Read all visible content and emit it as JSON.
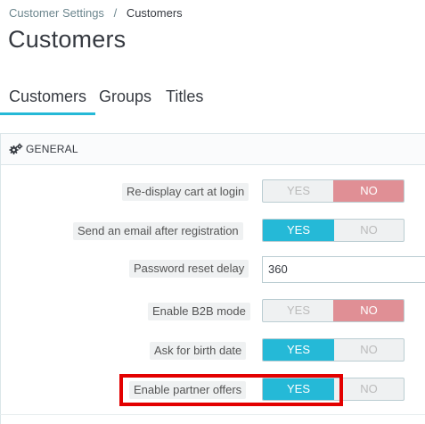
{
  "breadcrumb": {
    "parent": "Customer Settings",
    "separator": "/",
    "current": "Customers"
  },
  "page_title": "Customers",
  "tabs": [
    {
      "label": "Customers",
      "active": true
    },
    {
      "label": "Groups",
      "active": false
    },
    {
      "label": "Titles",
      "active": false
    }
  ],
  "panel": {
    "icon": "cogs-icon",
    "title": "GENERAL",
    "fields": [
      {
        "label": "Re-display cart at login",
        "type": "switch",
        "yes": "YES",
        "no": "NO",
        "value": "NO"
      },
      {
        "label": "Send an email after registration",
        "type": "switch",
        "yes": "YES",
        "no": "NO",
        "value": "YES"
      },
      {
        "label": "Password reset delay",
        "type": "text",
        "value": "360"
      },
      {
        "label": "Enable B2B mode",
        "type": "switch",
        "yes": "YES",
        "no": "NO",
        "value": "NO"
      },
      {
        "label": "Ask for birth date",
        "type": "switch",
        "yes": "YES",
        "no": "NO",
        "value": "YES"
      },
      {
        "label": "Enable partner offers",
        "type": "switch",
        "yes": "YES",
        "no": "NO",
        "value": "YES",
        "highlighted": true
      }
    ]
  },
  "colors": {
    "accent": "#25b9d7",
    "no_active": "#e08f95",
    "highlight": "#e30000"
  }
}
